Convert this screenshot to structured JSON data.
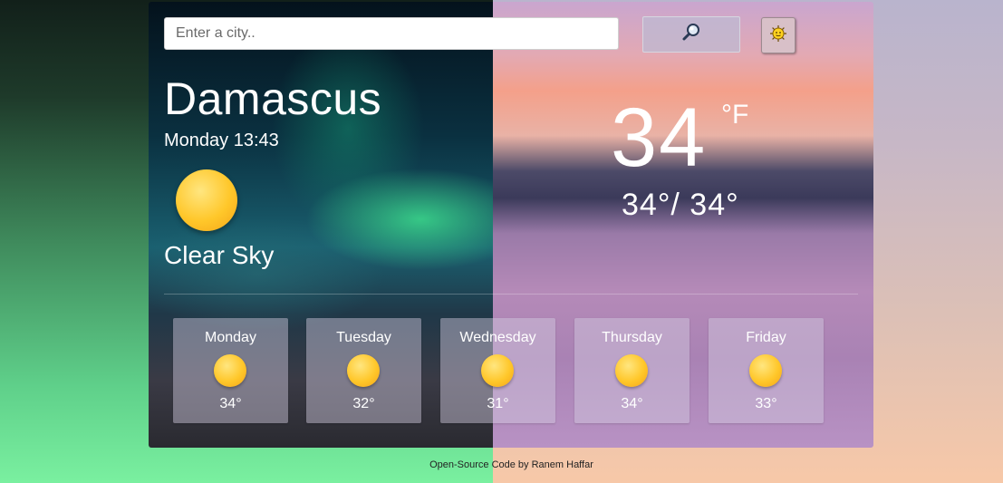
{
  "search": {
    "placeholder": "Enter a city.."
  },
  "buttons": {
    "search_icon": "magnifier-icon",
    "unit_icon": "sun-gear-icon"
  },
  "current": {
    "city": "Damascus",
    "datetime": "Monday 13:43",
    "condition": "Clear Sky",
    "condition_icon": "sun-icon",
    "temperature": "34",
    "unit": "°F",
    "min_max": "34°/ 34°"
  },
  "forecast": [
    {
      "day": "Monday",
      "temp": "34°",
      "icon": "sun-icon"
    },
    {
      "day": "Tuesday",
      "temp": "32°",
      "icon": "sun-icon"
    },
    {
      "day": "Wednesday",
      "temp": "31°",
      "icon": "sun-icon"
    },
    {
      "day": "Thursday",
      "temp": "34°",
      "icon": "sun-icon"
    },
    {
      "day": "Friday",
      "temp": "33°",
      "icon": "sun-icon"
    }
  ],
  "footer": {
    "link_text": "Open-Source Code",
    "by_text": " by Ranem Haffar"
  },
  "colors": {
    "accent_sun": "#ffc72a",
    "card_glass": "#d2cde1"
  }
}
